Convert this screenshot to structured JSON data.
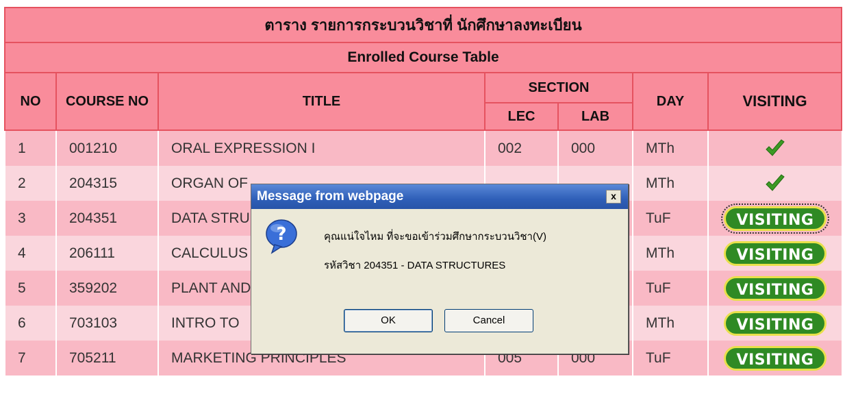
{
  "table": {
    "title_thai": "ตาราง รายการกระบวนวิชาที่ นักศึกษาลงทะเบียน",
    "title_en": "Enrolled Course Table",
    "headers": {
      "no": "NO",
      "course_no": "COURSE NO",
      "title": "TITLE",
      "section": "SECTION",
      "lec": "LEC",
      "lab": "LAB",
      "day": "DAY",
      "visiting": "VISITING"
    },
    "rows": [
      {
        "no": "1",
        "course_no": "001210",
        "title": "ORAL EXPRESSION I",
        "lec": "002",
        "lab": "000",
        "day": "MTh",
        "visiting": "check"
      },
      {
        "no": "2",
        "course_no": "204315",
        "title": "ORGAN OF",
        "lec": "",
        "lab": "",
        "day": "MTh",
        "visiting": "check"
      },
      {
        "no": "3",
        "course_no": "204351",
        "title": "DATA STRU",
        "lec": "",
        "lab": "",
        "day": "TuF",
        "visiting": "button"
      },
      {
        "no": "4",
        "course_no": "206111",
        "title": "CALCULUS",
        "lec": "",
        "lab": "",
        "day": "MTh",
        "visiting": "button"
      },
      {
        "no": "5",
        "course_no": "359202",
        "title": "PLANT AND",
        "lec": "",
        "lab": "",
        "day": "TuF",
        "visiting": "button"
      },
      {
        "no": "6",
        "course_no": "703103",
        "title": "INTRO TO",
        "lec": "",
        "lab": "",
        "day": "MTh",
        "visiting": "button"
      },
      {
        "no": "7",
        "course_no": "705211",
        "title": "MARKETING PRINCIPLES",
        "lec": "005",
        "lab": "000",
        "day": "TuF",
        "visiting": "button"
      }
    ],
    "visiting_button_label": "VISITING"
  },
  "dialog": {
    "title": "Message from webpage",
    "close_label": "x",
    "message_line1": "คุณแน่ใจไหม ที่จะขอเข้าร่วมศึกษากระบวนวิชา(V)",
    "message_line2": "รหัสวิชา 204351 - DATA STRUCTURES",
    "ok_label": "OK",
    "cancel_label": "Cancel",
    "icon": "question-icon"
  },
  "colors": {
    "header_bg": "#f98c9b",
    "row_odd": "#f9b9c5",
    "row_even": "#fad6dd",
    "visit_button": "#2f8a24",
    "dialog_title": "#2f5fb8"
  }
}
